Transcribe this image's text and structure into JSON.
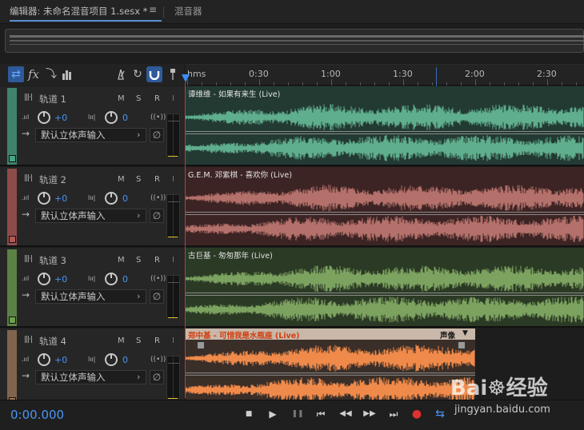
{
  "tabs": {
    "editor": "编辑器: 未命名混音项目 1.sesx *",
    "menu": "≡",
    "mixer": "混音器"
  },
  "toolbar": {
    "swap_icon": "⇄",
    "fx_label": "fx",
    "route_icon": "⤵",
    "meter_icon": "▮▮▮",
    "metronome_icon": "⏃",
    "loop_icon": "↻",
    "snap_icon": "∩",
    "pin_icon": "▾"
  },
  "ruler": {
    "labels": [
      "hms",
      "0:30",
      "1:00",
      "1:30",
      "2:00",
      "2:30"
    ]
  },
  "tracks": [
    {
      "name": "轨道 1",
      "volume": "+0",
      "pan": "0",
      "input": "默认立体声输入",
      "m": "M",
      "s": "S",
      "r": "R",
      "i": "I",
      "color": "#4aa383",
      "clip": "谭维维 - 如果有来生 (Live)",
      "clip_bg": "#233a33",
      "wave": "#5fae8e"
    },
    {
      "name": "轨道 2",
      "volume": "+0",
      "pan": "0",
      "input": "默认立体声输入",
      "m": "M",
      "s": "S",
      "r": "R",
      "i": "I",
      "color": "#b05a55",
      "clip": "G.E.M. 邓紫棋 - 喜欢你 (Live)",
      "clip_bg": "#3d2424",
      "wave": "#b4706a"
    },
    {
      "name": "轨道 3",
      "volume": "+0",
      "pan": "0",
      "input": "默认立体声输入",
      "m": "M",
      "s": "S",
      "r": "R",
      "i": "I",
      "color": "#6fa050",
      "clip": "古巨基 - 匆匆那年 (Live)",
      "clip_bg": "#2b3a25",
      "wave": "#7ca260"
    },
    {
      "name": "轨道 4",
      "volume": "+0",
      "pan": "0",
      "input": "默认立体声输入",
      "m": "M",
      "s": "S",
      "r": "R",
      "i": "I",
      "color": "#a07a5a",
      "clip": "郑中基 - 可惜我是水瓶座 (Live)",
      "clip_bg": "#3a2e28",
      "wave": "#f08a4a",
      "clip_extra": "声像"
    }
  ],
  "transport": {
    "timecode": "0:00.000",
    "stop": "■",
    "play": "▶",
    "pause": "❚❚",
    "to_start": "⏮",
    "rewind": "◀◀",
    "forward": "▶▶",
    "to_end": "⏭",
    "record": "●",
    "loop": "⇆"
  },
  "watermark": {
    "logo": "Bai☸经验",
    "url": "jingyan.baidu.com"
  },
  "colors": {
    "accent": "#4a95f2",
    "playhead": "#c23a3a"
  }
}
